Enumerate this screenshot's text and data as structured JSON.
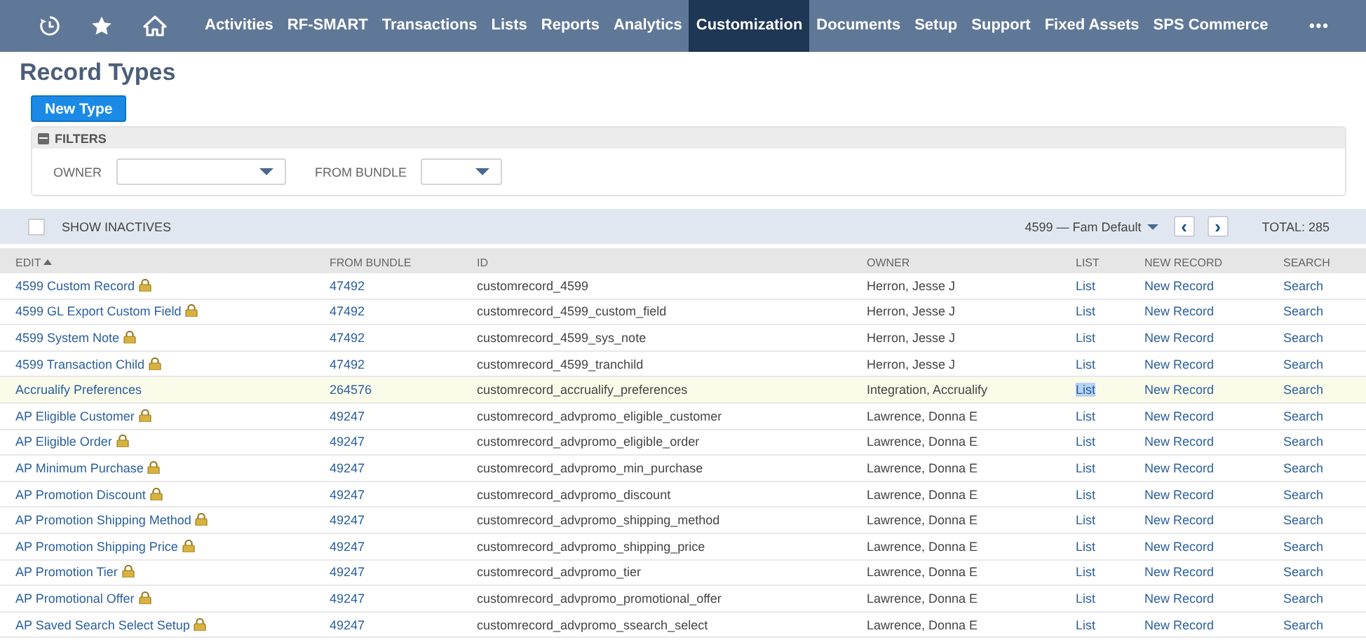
{
  "nav": {
    "items": [
      {
        "kind": "history"
      },
      {
        "kind": "star"
      },
      {
        "kind": "home"
      },
      {
        "label": "Activities",
        "selected": false
      },
      {
        "label": "RF-SMART",
        "selected": false
      },
      {
        "label": "Transactions",
        "selected": false
      },
      {
        "label": "Lists",
        "selected": false
      },
      {
        "label": "Reports",
        "selected": false
      },
      {
        "label": "Analytics",
        "selected": false
      },
      {
        "label": "Customization",
        "selected": true
      },
      {
        "label": "Documents",
        "selected": false
      },
      {
        "label": "Setup",
        "selected": false
      },
      {
        "label": "Support",
        "selected": false
      },
      {
        "label": "Fixed Assets",
        "selected": false
      },
      {
        "label": "SPS Commerce",
        "selected": false
      }
    ],
    "more": "•••"
  },
  "title": "Record Types",
  "new_button": "New Type",
  "filters": {
    "title": "FILTERS",
    "expanded": true,
    "fields": [
      {
        "label": "OWNER",
        "kind": "wide"
      },
      {
        "label": "FROM BUNDLE",
        "kind": "narrow"
      }
    ]
  },
  "toolbar": {
    "show_inactives": {
      "label": "SHOW INACTIVES",
      "checked": false
    },
    "view": "4599 — Fam Default",
    "prev": "‹",
    "next": "›",
    "total": "TOTAL: 285"
  },
  "table": {
    "columns": [
      {
        "label": "EDIT",
        "sorted": true
      },
      {
        "label": "FROM BUNDLE",
        "sorted": false
      },
      {
        "label": "ID",
        "sorted": false
      },
      {
        "label": "OWNER",
        "sorted": false
      },
      {
        "label": "LIST",
        "sorted": false
      },
      {
        "label": "NEW RECORD",
        "sorted": false
      },
      {
        "label": "SEARCH",
        "sorted": false
      }
    ],
    "rows": [
      {
        "name": "4599 Custom Record",
        "locked": true,
        "bundle": "47492",
        "id": "customrecord_4599",
        "owner": "Herron, Jesse J",
        "list": "List",
        "new": "New Record",
        "search": "Search",
        "selected": false
      },
      {
        "name": "4599 GL Export Custom Field",
        "locked": true,
        "bundle": "47492",
        "id": "customrecord_4599_custom_field",
        "owner": "Herron, Jesse J",
        "list": "List",
        "new": "New Record",
        "search": "Search",
        "selected": false
      },
      {
        "name": "4599 System Note",
        "locked": true,
        "bundle": "47492",
        "id": "customrecord_4599_sys_note",
        "owner": "Herron, Jesse J",
        "list": "List",
        "new": "New Record",
        "search": "Search",
        "selected": false
      },
      {
        "name": "4599 Transaction Child",
        "locked": true,
        "bundle": "47492",
        "id": "customrecord_4599_tranchild",
        "owner": "Herron, Jesse J",
        "list": "List",
        "new": "New Record",
        "search": "Search",
        "selected": false
      },
      {
        "name": "Accrualify Preferences",
        "locked": false,
        "bundle": "264576",
        "id": "customrecord_accrualify_preferences",
        "owner": "Integration, Accrualify",
        "list": "List",
        "new": "New Record",
        "search": "Search",
        "selected": true
      },
      {
        "name": "AP Eligible Customer",
        "locked": true,
        "bundle": "49247",
        "id": "customrecord_advpromo_eligible_customer",
        "owner": "Lawrence, Donna E",
        "list": "List",
        "new": "New Record",
        "search": "Search",
        "selected": false
      },
      {
        "name": "AP Eligible Order",
        "locked": true,
        "bundle": "49247",
        "id": "customrecord_advpromo_eligible_order",
        "owner": "Lawrence, Donna E",
        "list": "List",
        "new": "New Record",
        "search": "Search",
        "selected": false
      },
      {
        "name": "AP Minimum Purchase",
        "locked": true,
        "bundle": "49247",
        "id": "customrecord_advpromo_min_purchase",
        "owner": "Lawrence, Donna E",
        "list": "List",
        "new": "New Record",
        "search": "Search",
        "selected": false
      },
      {
        "name": "AP Promotion Discount",
        "locked": true,
        "bundle": "49247",
        "id": "customrecord_advpromo_discount",
        "owner": "Lawrence, Donna E",
        "list": "List",
        "new": "New Record",
        "search": "Search",
        "selected": false
      },
      {
        "name": "AP Promotion Shipping Method",
        "locked": true,
        "bundle": "49247",
        "id": "customrecord_advpromo_shipping_method",
        "owner": "Lawrence, Donna E",
        "list": "List",
        "new": "New Record",
        "search": "Search",
        "selected": false
      },
      {
        "name": "AP Promotion Shipping Price",
        "locked": true,
        "bundle": "49247",
        "id": "customrecord_advpromo_shipping_price",
        "owner": "Lawrence, Donna E",
        "list": "List",
        "new": "New Record",
        "search": "Search",
        "selected": false
      },
      {
        "name": "AP Promotion Tier",
        "locked": true,
        "bundle": "49247",
        "id": "customrecord_advpromo_tier",
        "owner": "Lawrence, Donna E",
        "list": "List",
        "new": "New Record",
        "search": "Search",
        "selected": false
      },
      {
        "name": "AP Promotional Offer",
        "locked": true,
        "bundle": "49247",
        "id": "customrecord_advpromo_promotional_offer",
        "owner": "Lawrence, Donna E",
        "list": "List",
        "new": "New Record",
        "search": "Search",
        "selected": false
      },
      {
        "name": "AP Saved Search Select Setup",
        "locked": true,
        "bundle": "49247",
        "id": "customrecord_advpromo_ssearch_select",
        "owner": "Lawrence, Donna E",
        "list": "List",
        "new": "New Record",
        "search": "Search",
        "selected": false
      }
    ]
  }
}
